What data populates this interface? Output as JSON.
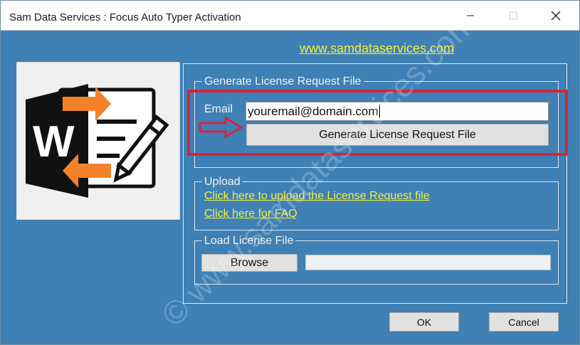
{
  "window": {
    "title": "Sam Data Services : Focus Auto Typer Activation",
    "controls": [
      "minimize-icon",
      "maximize-icon",
      "close-icon"
    ]
  },
  "header": {
    "website": "www.samdataservices.com"
  },
  "watermark": "© www.samdataservices.com",
  "generate_group": {
    "legend": "Generate License Request File",
    "email_label": "Email",
    "email_value": "youremail@domain.com",
    "button_label": "Generate License Request File"
  },
  "upload_group": {
    "legend": "Upload",
    "upload_link": "Click here to upload the License Request file",
    "faq_link": "Click here for FAQ"
  },
  "load_group": {
    "legend": "Load License File",
    "browse_label": "Browse",
    "file_path": ""
  },
  "footer": {
    "ok_label": "OK",
    "cancel_label": "Cancel"
  },
  "colors": {
    "background": "#3f80b5",
    "link": "#f4ef3a",
    "highlight": "#d4253a",
    "logo_orange": "#f5822a"
  }
}
